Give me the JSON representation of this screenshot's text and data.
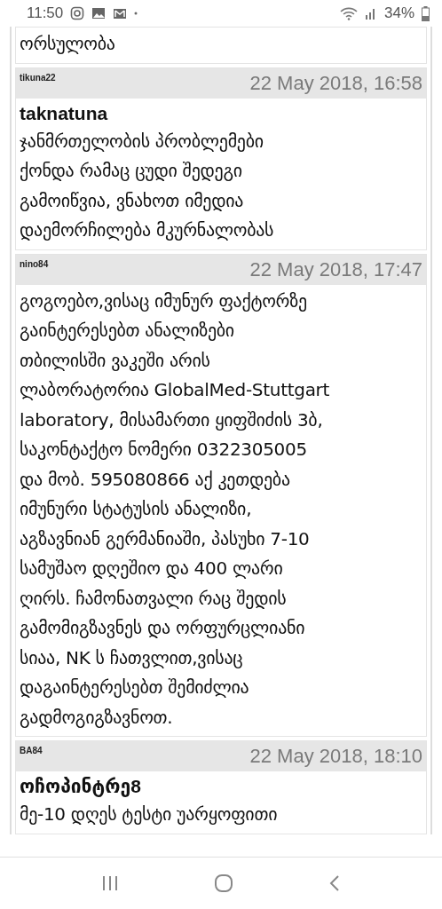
{
  "status_bar": {
    "time": "11:50",
    "battery": "34%"
  },
  "posts": [
    {
      "body": "ორსულობა"
    },
    {
      "user": "tikuna22",
      "date": "22 May 2018, 16:58",
      "title": "taknatuna",
      "body": "ჯანმრთელობის პრობლემები\nქონდა რამაც ცუდი შედეგი\nგამოიწვია, ვნახოთ იმედია\nდაემორჩილება მკურნალობას"
    },
    {
      "user": "nino84",
      "date": "22 May 2018, 17:47",
      "body": "გოგოებო,ვისაც იმუნურ ფაქტორზე\nგაინტერესებთ ანალიზები\nთბილისში ვაკეში არის\nლაბორატორია GlobalMed-Stuttgart\nlaboratory, მისამართი ყიფშიძის 3ბ,\nსაკონტაქტო ნომერი 0322305005\nდა მობ. 595080866 აქ კეთდება\nიმუნური სტატუსის ანალიზი,\nაგზავნიან გერმანიაში, პასუხი 7-10\nსამუშაო დღეშიო და 400 ლარი\nღირს. ჩამონათვალი რაც შედის\nგამომიგზავნეს და ორფურცლიანი\nსიაა, NK ს ჩათვლით,ვისაც\nდაგაინტერესებთ შემიძლია\nგადმოგიგზავნოთ."
    },
    {
      "user": "BA84",
      "date": "22 May 2018, 18:10",
      "title": "ოჩოპინტრე8",
      "body": "მე-10 დღეს ტესტი უარყოფითი"
    }
  ]
}
